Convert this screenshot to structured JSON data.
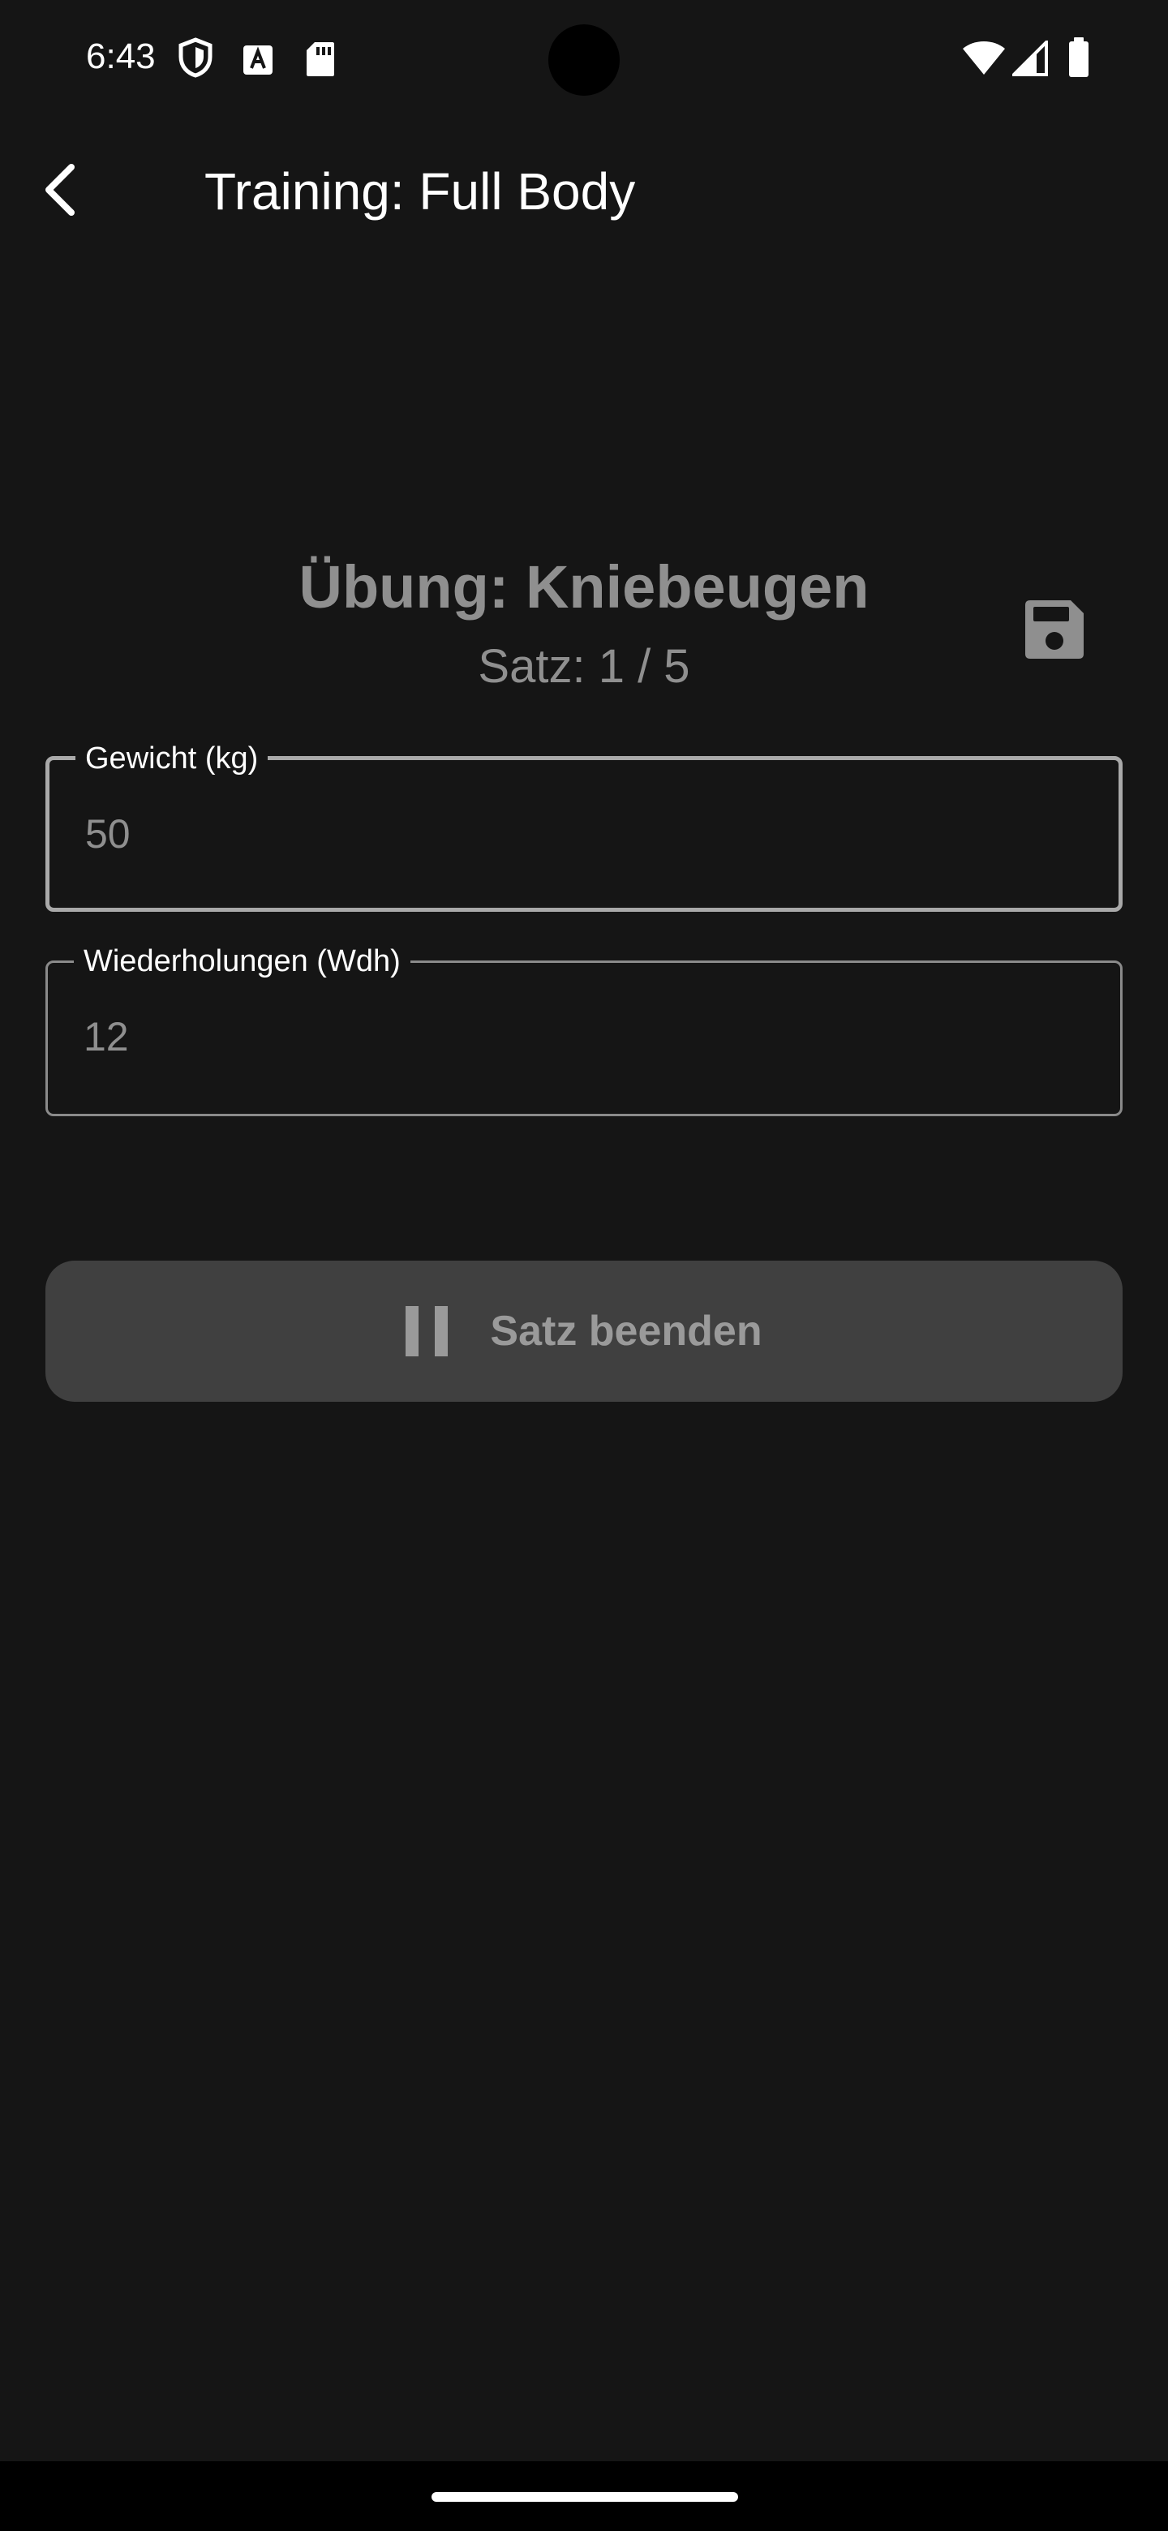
{
  "status_bar": {
    "time": "6:43",
    "left_icons": [
      "shield-icon",
      "text-a-icon",
      "sd-card-icon"
    ],
    "right_icons": [
      "wifi-icon",
      "signal-icon",
      "battery-icon"
    ]
  },
  "app_bar": {
    "back_icon": "back-arrow-icon",
    "title": "Training: Full Body"
  },
  "exercise": {
    "title": "Übung: Kniebeugen",
    "set_counter": "Satz: 1 / 5",
    "save_icon": "save-icon"
  },
  "fields": {
    "weight": {
      "label": "Gewicht (kg)",
      "value": "50"
    },
    "reps": {
      "label": "Wiederholungen (Wdh)",
      "value": "12"
    }
  },
  "actions": {
    "finish_set_label": "Satz beenden",
    "finish_set_icon": "pause-icon"
  },
  "colors": {
    "background": "#151515",
    "muted_text": "#8f8f8f",
    "button_bg": "#404040"
  }
}
